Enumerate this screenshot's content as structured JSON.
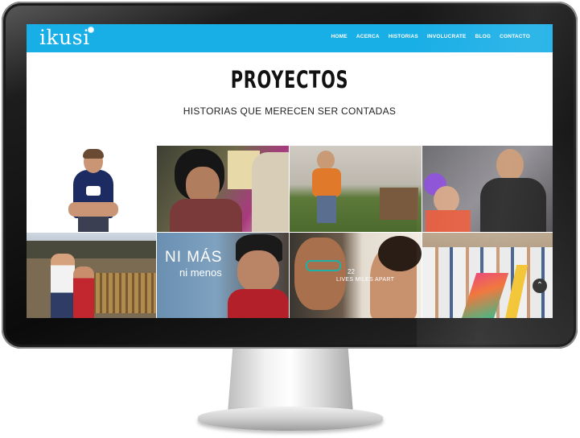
{
  "site": {
    "logo_text": "ikusi",
    "brand_color": "#18aee6"
  },
  "nav": {
    "items": [
      "HOME",
      "ACERCA",
      "HISTORIAS",
      "INVOLUCRATE",
      "BLOG",
      "CONTACTO"
    ]
  },
  "page": {
    "title": "PROYECTOS",
    "subtitle": "HISTORIAS QUE MERECEN SER CONTADAS"
  },
  "projects": {
    "tile2_overlay_line1": "NI MÁS",
    "tile2_overlay_line2": "ni menos",
    "tile3_overlay_line1": "22",
    "tile3_overlay_line2": "LIVES MILES APART"
  },
  "controls": {
    "scroll_top_icon": "chevron-up-icon"
  }
}
